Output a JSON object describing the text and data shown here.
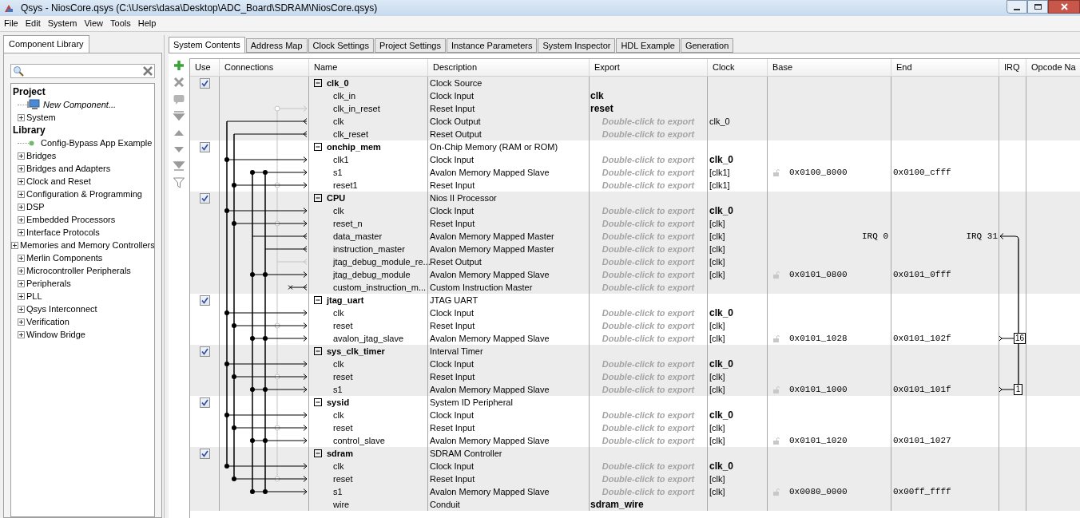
{
  "window": {
    "title": "Qsys - NiosCore.qsys (C:\\Users\\dasa\\Desktop\\ADC_Board\\SDRAM\\NiosCore.qsys)"
  },
  "menu": [
    "File",
    "Edit",
    "System",
    "View",
    "Tools",
    "Help"
  ],
  "library": {
    "tab": "Component Library",
    "tree": [
      {
        "label": "Project",
        "kind": "heading",
        "children": [
          {
            "label": "New Component...",
            "kind": "component"
          },
          {
            "label": "System",
            "kind": "folder",
            "expanded": false
          }
        ]
      },
      {
        "label": "Library",
        "kind": "heading",
        "children": [
          {
            "label": "Config-Bypass App Example",
            "kind": "ip"
          },
          {
            "label": "Bridges",
            "kind": "folder",
            "expanded": false
          },
          {
            "label": "Bridges and Adapters",
            "kind": "folder",
            "expanded": false
          },
          {
            "label": "Clock and Reset",
            "kind": "folder",
            "expanded": false
          },
          {
            "label": "Configuration & Programming",
            "kind": "folder",
            "expanded": false
          },
          {
            "label": "DSP",
            "kind": "folder",
            "expanded": false
          },
          {
            "label": "Embedded Processors",
            "kind": "folder",
            "expanded": false
          },
          {
            "label": "Interface Protocols",
            "kind": "folder",
            "expanded": false
          },
          {
            "label": "Memories and Memory Controllers",
            "kind": "folder",
            "expanded": false
          },
          {
            "label": "Merlin Components",
            "kind": "folder",
            "expanded": false
          },
          {
            "label": "Microcontroller Peripherals",
            "kind": "folder",
            "expanded": false
          },
          {
            "label": "Peripherals",
            "kind": "folder",
            "expanded": false
          },
          {
            "label": "PLL",
            "kind": "folder",
            "expanded": false
          },
          {
            "label": "Qsys Interconnect",
            "kind": "folder",
            "expanded": false
          },
          {
            "label": "Verification",
            "kind": "folder",
            "expanded": false
          },
          {
            "label": "Window Bridge",
            "kind": "folder",
            "expanded": false
          }
        ]
      }
    ]
  },
  "tabs": [
    {
      "label": "System Contents",
      "selected": true
    },
    {
      "label": "Address Map",
      "selected": false
    },
    {
      "label": "Clock Settings",
      "selected": false
    },
    {
      "label": "Project Settings",
      "selected": false
    },
    {
      "label": "Instance Parameters",
      "selected": false
    },
    {
      "label": "System Inspector",
      "selected": false
    },
    {
      "label": "HDL Example",
      "selected": false
    },
    {
      "label": "Generation",
      "selected": false
    }
  ],
  "table": {
    "columns": [
      "Use",
      "Connections",
      "Name",
      "Description",
      "Export",
      "Clock",
      "Base",
      "End",
      "IRQ",
      "Opcode Na"
    ],
    "components": [
      {
        "name": "clk_0",
        "description": "Clock Source",
        "checked": true,
        "expanded": true,
        "interfaces": [
          {
            "name": "clk_in",
            "description": "Clock Input",
            "export": {
              "text": "clk",
              "kind": "value"
            },
            "kind": "none"
          },
          {
            "name": "clk_in_reset",
            "description": "Reset Input",
            "export": {
              "text": "reset",
              "kind": "value"
            },
            "kind": "unconnected_reset"
          },
          {
            "name": "clk",
            "description": "Clock Output",
            "export": {
              "text": "Double-click to export",
              "kind": "hint"
            },
            "clock": "clk_0",
            "clock_bold": false,
            "kind": "clock_out"
          },
          {
            "name": "clk_reset",
            "description": "Reset Output",
            "export": {
              "text": "Double-click to export",
              "kind": "hint"
            },
            "kind": "reset_out"
          }
        ]
      },
      {
        "name": "onchip_mem",
        "description": "On-Chip Memory (RAM or ROM)",
        "checked": true,
        "expanded": true,
        "interfaces": [
          {
            "name": "clk1",
            "description": "Clock Input",
            "export": {
              "text": "Double-click to export",
              "kind": "hint"
            },
            "clock": "clk_0",
            "clock_bold": true,
            "kind": "clock_in"
          },
          {
            "name": "s1",
            "description": "Avalon Memory Mapped Slave",
            "export": {
              "text": "Double-click to export",
              "kind": "hint"
            },
            "clock": "[clk1]",
            "clock_bold": false,
            "base": "0x0100_8000",
            "end": "0x0100_cfff",
            "kind": "slave"
          },
          {
            "name": "reset1",
            "description": "Reset Input",
            "export": {
              "text": "Double-click to export",
              "kind": "hint"
            },
            "clock": "[clk1]",
            "clock_bold": false,
            "kind": "reset_in"
          }
        ]
      },
      {
        "name": "CPU",
        "description": "Nios II Processor",
        "checked": true,
        "expanded": true,
        "interfaces": [
          {
            "name": "clk",
            "description": "Clock Input",
            "export": {
              "text": "Double-click to export",
              "kind": "hint"
            },
            "clock": "clk_0",
            "clock_bold": true,
            "kind": "clock_in"
          },
          {
            "name": "reset_n",
            "description": "Reset Input",
            "export": {
              "text": "Double-click to export",
              "kind": "hint"
            },
            "clock": "[clk]",
            "clock_bold": false,
            "kind": "reset_in"
          },
          {
            "name": "data_master",
            "description": "Avalon Memory Mapped Master",
            "export": {
              "text": "Double-click to export",
              "kind": "hint"
            },
            "clock": "[clk]",
            "clock_bold": false,
            "irq_from": "IRQ 0",
            "irq_to": "IRQ 31",
            "kind": "master_data"
          },
          {
            "name": "instruction_master",
            "description": "Avalon Memory Mapped Master",
            "export": {
              "text": "Double-click to export",
              "kind": "hint"
            },
            "clock": "[clk]",
            "clock_bold": false,
            "kind": "master_instr"
          },
          {
            "name": "jtag_debug_module_re...",
            "description": "Reset Output",
            "export": {
              "text": "Double-click to export",
              "kind": "hint"
            },
            "clock": "[clk]",
            "clock_bold": false,
            "kind": "reset_out_grey"
          },
          {
            "name": "jtag_debug_module",
            "description": "Avalon Memory Mapped Slave",
            "export": {
              "text": "Double-click to export",
              "kind": "hint"
            },
            "clock": "[clk]",
            "clock_bold": false,
            "base": "0x0101_0800",
            "end": "0x0101_0fff",
            "kind": "slave"
          },
          {
            "name": "custom_instruction_m...",
            "description": "Custom Instruction Master",
            "export": {
              "text": "Double-click to export",
              "kind": "hint"
            },
            "kind": "custom"
          }
        ]
      },
      {
        "name": "jtag_uart",
        "description": "JTAG UART",
        "checked": true,
        "expanded": true,
        "interfaces": [
          {
            "name": "clk",
            "description": "Clock Input",
            "export": {
              "text": "Double-click to export",
              "kind": "hint"
            },
            "clock": "clk_0",
            "clock_bold": true,
            "kind": "clock_in"
          },
          {
            "name": "reset",
            "description": "Reset Input",
            "export": {
              "text": "Double-click to export",
              "kind": "hint"
            },
            "clock": "[clk]",
            "clock_bold": false,
            "kind": "reset_in"
          },
          {
            "name": "avalon_jtag_slave",
            "description": "Avalon Memory Mapped Slave",
            "export": {
              "text": "Double-click to export",
              "kind": "hint"
            },
            "clock": "[clk]",
            "clock_bold": false,
            "base": "0x0101_1028",
            "end": "0x0101_102f",
            "irq": "16",
            "kind": "slave"
          }
        ]
      },
      {
        "name": "sys_clk_timer",
        "description": "Interval Timer",
        "checked": true,
        "expanded": true,
        "interfaces": [
          {
            "name": "clk",
            "description": "Clock Input",
            "export": {
              "text": "Double-click to export",
              "kind": "hint"
            },
            "clock": "clk_0",
            "clock_bold": true,
            "kind": "clock_in"
          },
          {
            "name": "reset",
            "description": "Reset Input",
            "export": {
              "text": "Double-click to export",
              "kind": "hint"
            },
            "clock": "[clk]",
            "clock_bold": false,
            "kind": "reset_in"
          },
          {
            "name": "s1",
            "description": "Avalon Memory Mapped Slave",
            "export": {
              "text": "Double-click to export",
              "kind": "hint"
            },
            "clock": "[clk]",
            "clock_bold": false,
            "base": "0x0101_1000",
            "end": "0x0101_101f",
            "irq": "1",
            "kind": "slave"
          }
        ]
      },
      {
        "name": "sysid",
        "description": "System ID Peripheral",
        "checked": true,
        "expanded": true,
        "interfaces": [
          {
            "name": "clk",
            "description": "Clock Input",
            "export": {
              "text": "Double-click to export",
              "kind": "hint"
            },
            "clock": "clk_0",
            "clock_bold": true,
            "kind": "clock_in"
          },
          {
            "name": "reset",
            "description": "Reset Input",
            "export": {
              "text": "Double-click to export",
              "kind": "hint"
            },
            "clock": "[clk]",
            "clock_bold": false,
            "kind": "reset_in"
          },
          {
            "name": "control_slave",
            "description": "Avalon Memory Mapped Slave",
            "export": {
              "text": "Double-click to export",
              "kind": "hint"
            },
            "clock": "[clk]",
            "clock_bold": false,
            "base": "0x0101_1020",
            "end": "0x0101_1027",
            "kind": "slave"
          }
        ]
      },
      {
        "name": "sdram",
        "description": "SDRAM Controller",
        "checked": true,
        "expanded": true,
        "interfaces": [
          {
            "name": "clk",
            "description": "Clock Input",
            "export": {
              "text": "Double-click to export",
              "kind": "hint"
            },
            "clock": "clk_0",
            "clock_bold": true,
            "kind": "clock_in"
          },
          {
            "name": "reset",
            "description": "Reset Input",
            "export": {
              "text": "Double-click to export",
              "kind": "hint"
            },
            "clock": "[clk]",
            "clock_bold": false,
            "kind": "reset_in"
          },
          {
            "name": "s1",
            "description": "Avalon Memory Mapped Slave",
            "export": {
              "text": "Double-click to export",
              "kind": "hint"
            },
            "clock": "[clk]",
            "clock_bold": false,
            "base": "0x0080_0000",
            "end": "0x00ff_ffff",
            "kind": "slave"
          },
          {
            "name": "wire",
            "description": "Conduit",
            "export": {
              "text": "sdram_wire",
              "kind": "value"
            },
            "kind": "none"
          }
        ]
      }
    ]
  }
}
